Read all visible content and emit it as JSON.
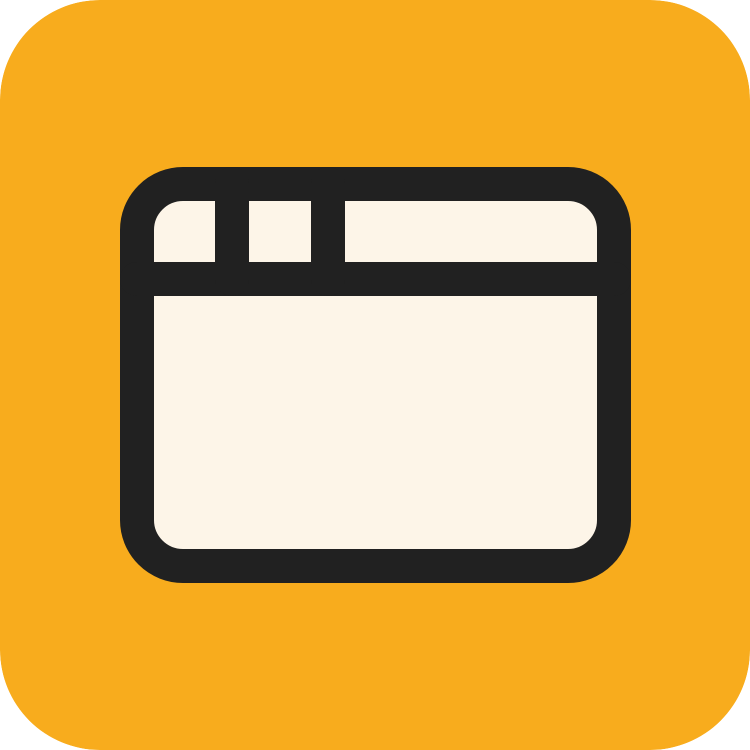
{
  "icon": {
    "name": "browser-window-icon",
    "colors": {
      "background": "#F8AC1D",
      "window_fill": "#FDF5E8",
      "stroke": "#212121"
    }
  }
}
